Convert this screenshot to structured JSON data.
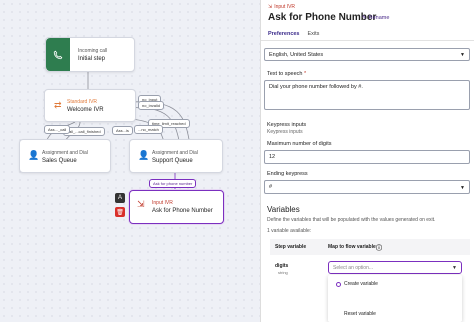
{
  "canvas": {
    "nodes": {
      "incoming": {
        "small": "Incoming call",
        "big": "Initial step"
      },
      "ivr": {
        "small": "Standard IVR",
        "big": "Welcome IVR"
      },
      "sales": {
        "small": "Assignment and Dial",
        "big": "Sales Queue"
      },
      "support": {
        "small": "Assignment and Dial",
        "big": "Support Queue"
      },
      "input": {
        "small": "Input IVR",
        "big": "Ask for Phone Number"
      }
    },
    "pills": {
      "no_input": "no_input",
      "no_invalid": "no_invalid",
      "time_limit": "time_limit_reached",
      "call_call": "call_...call_finished",
      "ass_call": "Ass..._call",
      "ass_is": "Ass...is",
      "no_match": "...no_match",
      "ask_phone": "Ask for phone number"
    }
  },
  "panel": {
    "crumb": "Input IVR",
    "title": "Ask for Phone Number",
    "rename": "Rename",
    "tabs": [
      "Preferences",
      "Exits"
    ],
    "language_value": "English, United States",
    "tts_label": "Text to speech",
    "tts_value": "Dial your phone number followed by #.",
    "keypress_label": "Keypress inputs",
    "keypress_sub": "Keypress inputs",
    "max_digits_label": "Maximum number of digits",
    "max_digits_value": "12",
    "ending_label": "Ending keypress",
    "ending_value": "#",
    "vars_title": "Variables",
    "vars_desc": "Define the variables that will be populated with the values generated on exit.",
    "vars_count": "1 variable available:",
    "col_step": "Step variable",
    "col_map": "Map to flow variable",
    "row_name": "digits",
    "row_type": "string",
    "select_placeholder": "Select an option...",
    "options": [
      "Create variable",
      "Reset variable"
    ]
  },
  "colors": {
    "accent": "#7b2fbf",
    "green": "#2e7d4f",
    "red": "#c0392b"
  }
}
